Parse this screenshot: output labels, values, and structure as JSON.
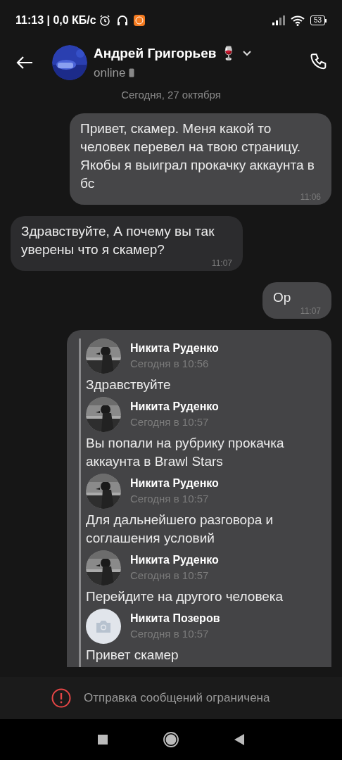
{
  "status_bar": {
    "time": "11:13 | 0,0 КБ/с",
    "battery": "53"
  },
  "header": {
    "name": "Андрей Григорьев 🍷",
    "status": "online"
  },
  "date_separator": "Сегодня, 27 октября",
  "messages": [
    {
      "kind": "text",
      "outgoing": true,
      "text": "Привет, скамер. Меня какой то человек перевел на твою страницу. Якобы я выиграл прокачку аккаунта в бс",
      "time": "11:06"
    },
    {
      "kind": "text",
      "outgoing": false,
      "text": "Здравствуйте, А почему вы так уверены что я скамер?",
      "time": "11:07"
    },
    {
      "kind": "text",
      "outgoing": true,
      "text": "Ор",
      "time": "11:07"
    },
    {
      "kind": "forwarded",
      "outgoing": true,
      "items": [
        {
          "author": "Никита Руденко",
          "time": "Сегодня в 10:56",
          "text": "Здравствуйте"
        },
        {
          "author": "Никита Руденко",
          "time": "Сегодня в 10:57",
          "text": "Вы попали на рубрику прокачка аккаунта в Brawl Stars"
        },
        {
          "author": "Никита Руденко",
          "time": "Сегодня в 10:57",
          "text": "Для дальнейшего разговора и соглашения условий"
        },
        {
          "author": "Никита Руденко",
          "time": "Сегодня в 10:57",
          "text": "Перейдите на другого человека"
        },
        {
          "kind": "placeholder",
          "author": "Никита Позеров",
          "time": "Сегодня в 10:57",
          "text": "Привет скамер"
        }
      ]
    }
  ],
  "footer": {
    "notice": "Отправка сообщений ограничена"
  }
}
